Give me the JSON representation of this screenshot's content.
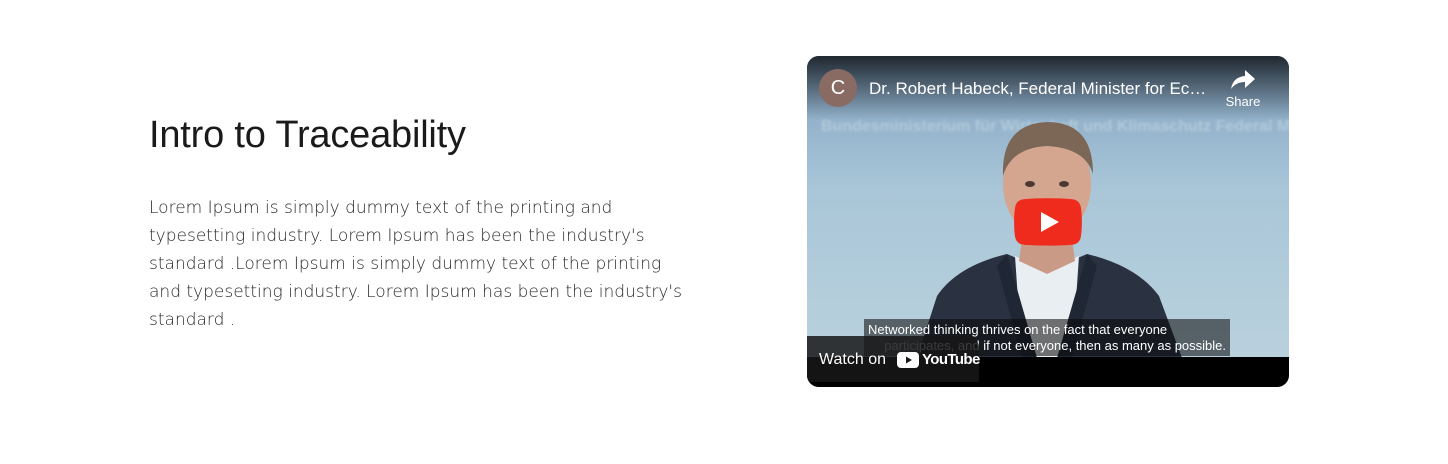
{
  "section": {
    "heading": "Intro to Traceability",
    "body": "Lorem Ipsum is simply dummy text of the printing and typesetting industry. Lorem Ipsum has been the industry's standard .Lorem Ipsum is simply dummy text of the printing and typesetting industry. Lorem Ipsum has been the industry's standard ."
  },
  "video": {
    "channel_initial": "C",
    "title": "Dr. Robert Habeck, Federal Minister for Economic Affairs and Climate Action",
    "share_label": "Share",
    "background_banner": "Bundesministerium für Wirtschaft und Klimaschutz   Federal Ministry for Economic Affairs",
    "caption_line1": "Networked thinking thrives on the fact that everyone",
    "caption_line2": "participates, and if not everyone, then as many as possible.",
    "watch_on_label": "Watch on",
    "youtube_wordmark": "YouTube",
    "colors": {
      "play_button": "#ff0000",
      "avatar": "#8a6b64"
    }
  }
}
